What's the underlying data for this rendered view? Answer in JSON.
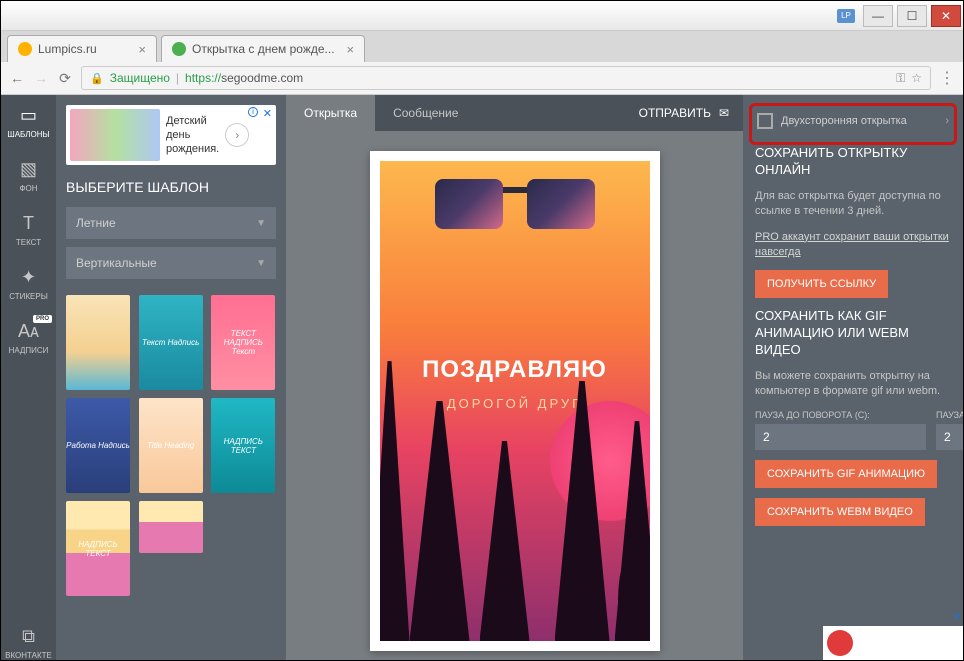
{
  "window": {
    "lp_badge": "LP"
  },
  "browser": {
    "tabs": [
      {
        "title": "Lumpics.ru"
      },
      {
        "title": "Открытка с днем рожде..."
      }
    ],
    "secure_label": "Защищено",
    "url_prefix": "https://",
    "url_host": "segoodme.com"
  },
  "rail": {
    "templates": "ШАБЛОНЫ",
    "background": "ФОН",
    "text": "ТЕКСТ",
    "stickers": "СТИКЕРЫ",
    "inscriptions": "НАДПИСИ",
    "pro": "PRO",
    "vk": "ВКОНТАКТЕ"
  },
  "ad": {
    "line1": "Детский",
    "line2": "день",
    "line3": "рождения."
  },
  "sidebar": {
    "heading": "ВЫБЕРИТЕ ШАБЛОН",
    "dd1": "Летние",
    "dd2": "Вертикальные",
    "thumbs": [
      "",
      "Текст Надпись",
      "ТЕКСТ НАДПИСЬ Текст",
      "Работа Надпись",
      "Title Heading",
      "НАДПИСЬ ТЕКСТ",
      "НАДПИСЬ ТЕКСТ",
      ""
    ]
  },
  "center_tabs": {
    "card": "Открытка",
    "message": "Сообщение",
    "send": "ОТПРАВИТЬ"
  },
  "card": {
    "title": "ПОЗДРАВЛЯЮ",
    "subtitle": "ДОРОГОЙ ДРУГ"
  },
  "right": {
    "doublesided": "Двухсторонняя открытка",
    "h1": "СОХРАНИТЬ ОТКРЫТКУ ОНЛАЙН",
    "t1": "Для вас открытка будет доступна по ссылке в течении 3 дней.",
    "link1": "PRO аккаунт сохранит ваши открытки навсегда",
    "btn1": "ПОЛУЧИТЬ ССЫЛКУ",
    "h2": "СОХРАНИТЬ КАК GIF АНИМАЦИЮ ИЛИ WEBM ВИДЕО",
    "t2": "Вы можете сохранить открытку на компьютер в формате gif или webm.",
    "pause_before_label": "ПАУЗА ДО ПОВОРОТА (С):",
    "pause_after_label": "ПАУЗА ПОСЛЕ (С):",
    "pause_before": "2",
    "pause_after": "2",
    "btn2": "СОХРАНИТЬ GIF АНИМАЦИЮ",
    "btn3": "СОХРАНИТЬ WEBM ВИДЕО"
  }
}
